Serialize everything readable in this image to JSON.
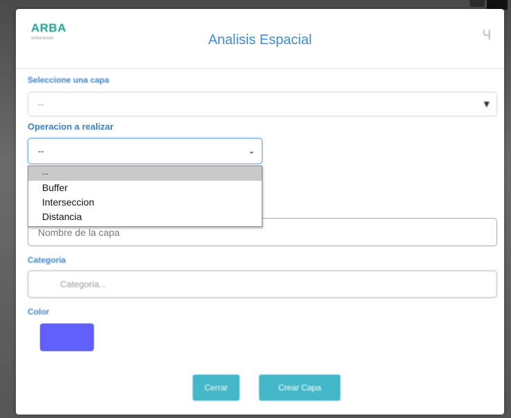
{
  "modal": {
    "logo": {
      "text": "ARBA",
      "subtext": "ARBA/ARBA"
    },
    "title": "Analisis Espacial",
    "close_glyph": "Ч"
  },
  "form": {
    "layer_label": "Seleccione una capa",
    "layer_value": "--",
    "operation_label": "Operacion a realizar",
    "operation_value": "--",
    "operation_options": [
      "--",
      "Buffer",
      "Interseccion",
      "Distancia"
    ],
    "operation_selected_index": 0,
    "name_placeholder": "Nombre de la capa",
    "category_label": "Categoria",
    "category_placeholder": "Categoria...",
    "color_label": "Color",
    "color_value": "#6060ff"
  },
  "buttons": {
    "close_label": "Cerrar",
    "create_label": "Crear Capa"
  },
  "colors": {
    "accent": "#3b8dd4",
    "button": "#43b7c7",
    "brand": "#1e9c8f"
  }
}
